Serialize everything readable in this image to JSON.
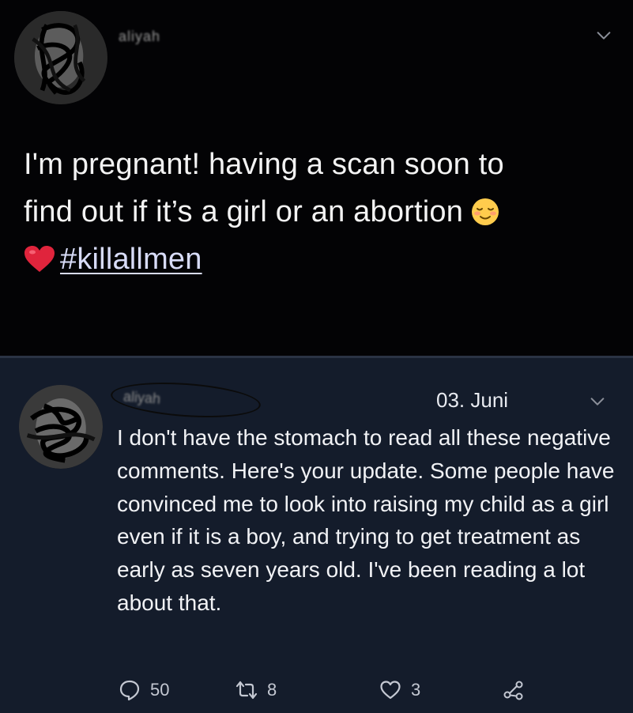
{
  "top_tweet": {
    "handle": "aliyah",
    "text_line1": "I'm pregnant! having a scan soon to",
    "text_line2": "find out if it’s a girl or an abortion",
    "hashtag": "#killallmen",
    "emoji_relieved": "relieved-face-emoji",
    "emoji_heart": "red-heart-emoji"
  },
  "reply": {
    "handle": "aliyah",
    "date": "03. Juni",
    "text": "I don't have the stomach to read all these negative comments. Here's your update. Some people have convinced me to look into raising my child as a girl even if it is a boy, and trying to get treatment as early as seven years old. I've been reading a lot about that.",
    "actions": {
      "reply_count": "50",
      "retweet_count": "8",
      "like_count": "3"
    }
  },
  "colors": {
    "top_background": "#030305",
    "reply_background": "#141c2b",
    "hashtag": "#d8dcf8",
    "heart": "#e0243c"
  }
}
